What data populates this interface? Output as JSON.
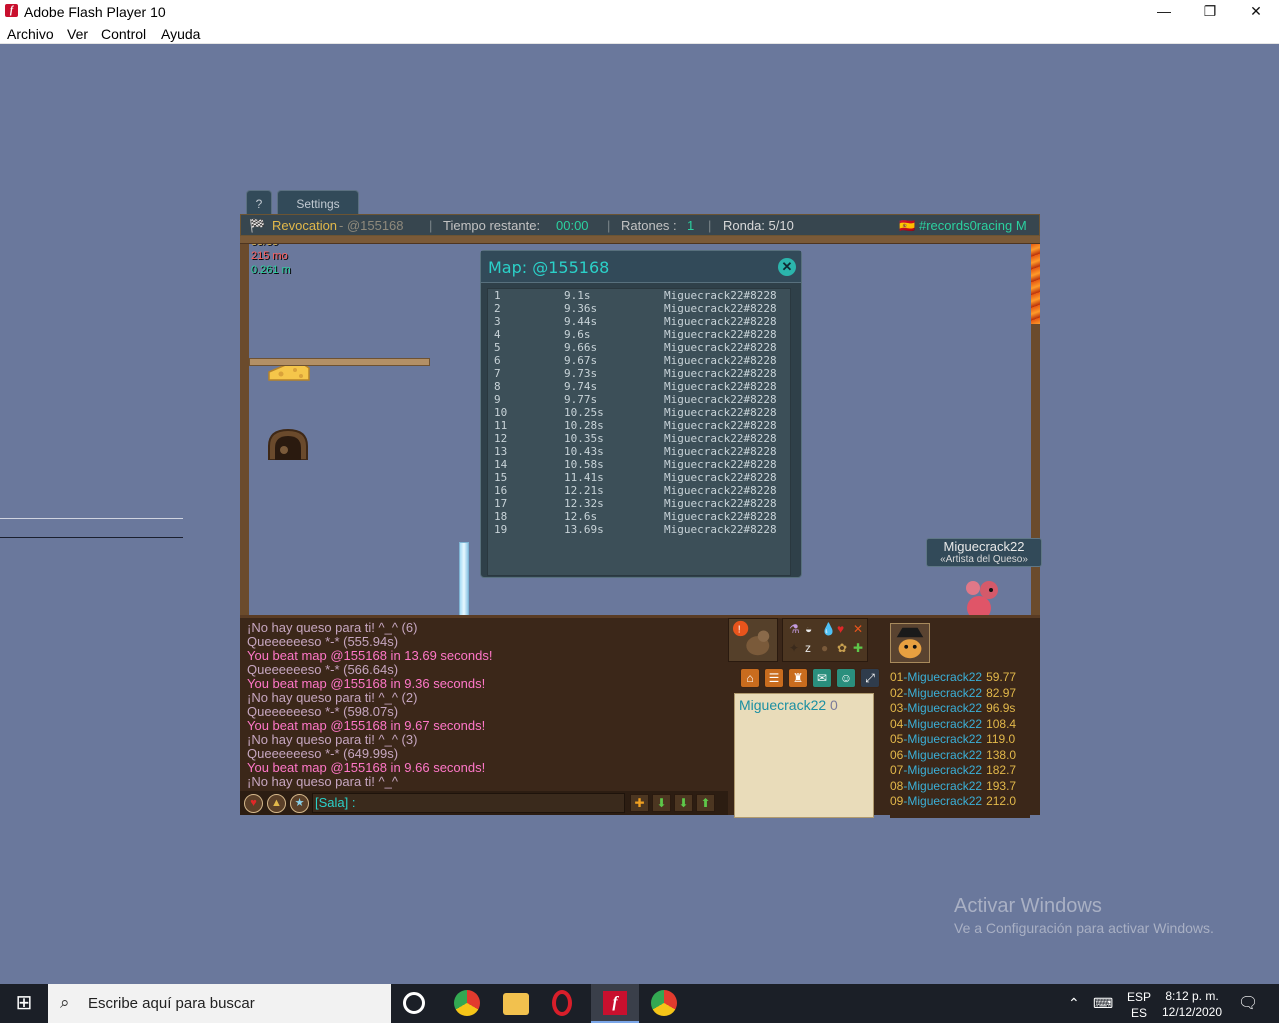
{
  "window": {
    "title": "Adobe Flash Player 10",
    "minimize": "—",
    "restore": "❐",
    "close": "✕"
  },
  "menu": [
    "Archivo",
    "Ver",
    "Control",
    "Ayuda"
  ],
  "game": {
    "tabs": {
      "help": "?",
      "settings": "Settings"
    },
    "topbar": {
      "map": "Revocation",
      "author": " - @155168",
      "time_label": "Tiempo restante: ",
      "time_value": "00:00",
      "mice_label": "Ratones : ",
      "mice_value": "1",
      "round": "Ronda: 5/10",
      "room": "#records0racing M"
    },
    "hud": {
      "count": "59/59",
      "distance_mo": "215 mo",
      "distance_m": "0.261 m"
    },
    "map_panel": {
      "title": "Map: @155168",
      "close": "✕",
      "rows": [
        {
          "rank": "1",
          "time": "9.1s",
          "player": "Miguecrack22#8228"
        },
        {
          "rank": "2",
          "time": "9.36s",
          "player": "Miguecrack22#8228"
        },
        {
          "rank": "3",
          "time": "9.44s",
          "player": "Miguecrack22#8228"
        },
        {
          "rank": "4",
          "time": "9.6s",
          "player": "Miguecrack22#8228"
        },
        {
          "rank": "5",
          "time": "9.66s",
          "player": "Miguecrack22#8228"
        },
        {
          "rank": "6",
          "time": "9.67s",
          "player": "Miguecrack22#8228"
        },
        {
          "rank": "7",
          "time": "9.73s",
          "player": "Miguecrack22#8228"
        },
        {
          "rank": "8",
          "time": "9.74s",
          "player": "Miguecrack22#8228"
        },
        {
          "rank": "9",
          "time": "9.77s",
          "player": "Miguecrack22#8228"
        },
        {
          "rank": "10",
          "time": "10.25s",
          "player": "Miguecrack22#8228"
        },
        {
          "rank": "11",
          "time": "10.28s",
          "player": "Miguecrack22#8228"
        },
        {
          "rank": "12",
          "time": "10.35s",
          "player": "Miguecrack22#8228"
        },
        {
          "rank": "13",
          "time": "10.43s",
          "player": "Miguecrack22#8228"
        },
        {
          "rank": "14",
          "time": "10.58s",
          "player": "Miguecrack22#8228"
        },
        {
          "rank": "15",
          "time": "11.41s",
          "player": "Miguecrack22#8228"
        },
        {
          "rank": "16",
          "time": "12.21s",
          "player": "Miguecrack22#8228"
        },
        {
          "rank": "17",
          "time": "12.32s",
          "player": "Miguecrack22#8228"
        },
        {
          "rank": "18",
          "time": "12.6s",
          "player": "Miguecrack22#8228"
        },
        {
          "rank": "19",
          "time": "13.69s",
          "player": "Miguecrack22#8228"
        }
      ]
    },
    "player_card": {
      "name": "Miguecrack22",
      "title": "«Artista del Queso»"
    },
    "chat": {
      "lines": [
        {
          "text": "¡No hay queso para ti! ^_^ (6)",
          "color": "#c6a6c0"
        },
        {
          "text": "Queeeeeeso *-* (555.94s)",
          "color": "#c6a6c0"
        },
        {
          "text": "You beat map @155168 in 13.69 seconds!",
          "color": "#ff77c8"
        },
        {
          "text": "Queeeeeeso *-* (566.64s)",
          "color": "#c6a6c0"
        },
        {
          "text": "You beat map @155168 in 9.36 seconds!",
          "color": "#ff77c8"
        },
        {
          "text": "¡No hay queso para ti! ^_^ (2)",
          "color": "#c6a6c0"
        },
        {
          "text": "Queeeeeeso *-* (598.07s)",
          "color": "#c6a6c0"
        },
        {
          "text": "You beat map @155168 in 9.67 seconds!",
          "color": "#ff77c8"
        },
        {
          "text": "¡No hay queso para ti! ^_^ (3)",
          "color": "#c6a6c0"
        },
        {
          "text": "Queeeeeeso *-* (649.99s)",
          "color": "#c6a6c0"
        },
        {
          "text": "You beat map @155168 in 9.66 seconds!",
          "color": "#ff77c8"
        },
        {
          "text": "¡No hay queso para ti! ^_^",
          "color": "#c6a6c0"
        }
      ],
      "input_placeholder": "[Sala] :"
    },
    "profile": {
      "name": "Miguecrack22",
      "score": "0"
    },
    "ranking": [
      {
        "pos": "01",
        "name": "-Miguecrack22",
        "time": "59.77"
      },
      {
        "pos": "02",
        "name": "-Miguecrack22",
        "time": "82.97"
      },
      {
        "pos": "03",
        "name": "-Miguecrack22",
        "time": "96.9s"
      },
      {
        "pos": "04",
        "name": "-Miguecrack22",
        "time": "108.4"
      },
      {
        "pos": "05",
        "name": "-Miguecrack22",
        "time": "119.0"
      },
      {
        "pos": "06",
        "name": "-Miguecrack22",
        "time": "138.0"
      },
      {
        "pos": "07",
        "name": "-Miguecrack22",
        "time": "182.7"
      },
      {
        "pos": "08",
        "name": "-Miguecrack22",
        "time": "193.7"
      },
      {
        "pos": "09",
        "name": "-Miguecrack22",
        "time": "212.0"
      }
    ]
  },
  "watermark": {
    "line1": "Activar Windows",
    "line2": "Ve a Configuración para activar Windows."
  },
  "taskbar": {
    "search_placeholder": "Escribe aquí para buscar",
    "lang": "ESP",
    "lang2": "ES",
    "time": "8:12 p. m.",
    "date": "12/12/2020"
  },
  "colors": {
    "teal": "#2bd1c9",
    "gold": "#e2b84a",
    "pink": "#ff77c8",
    "green": "#2bd1a0"
  }
}
